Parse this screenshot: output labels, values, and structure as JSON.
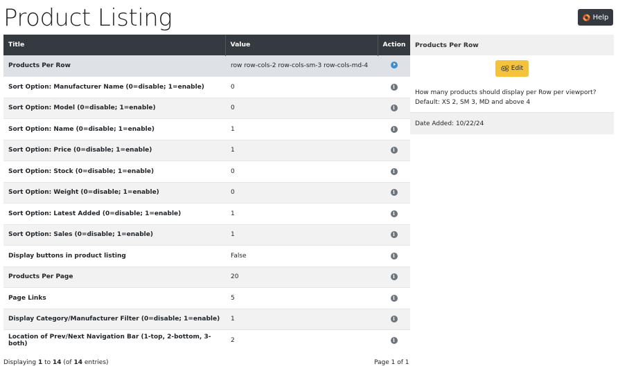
{
  "header": {
    "title": "Product Listing",
    "help_label": "Help"
  },
  "table": {
    "columns": [
      "Title",
      "Value",
      "Action"
    ],
    "rows": [
      {
        "title": "Products Per Row",
        "value": "row row-cols-2 row-cols-sm-3 row-cols-md-4",
        "action": "arrow-right-circle-icon"
      },
      {
        "title": "Sort Option: Manufacturer Name (0=disable; 1=enable)",
        "value": "0",
        "action": "info-icon"
      },
      {
        "title": "Sort Option: Model (0=disable; 1=enable)",
        "value": "0",
        "action": "info-icon"
      },
      {
        "title": "Sort Option: Name (0=disable; 1=enable)",
        "value": "1",
        "action": "info-icon"
      },
      {
        "title": "Sort Option: Price (0=disable; 1=enable)",
        "value": "1",
        "action": "info-icon"
      },
      {
        "title": "Sort Option: Stock (0=disable; 1=enable)",
        "value": "0",
        "action": "info-icon"
      },
      {
        "title": "Sort Option: Weight (0=disable; 1=enable)",
        "value": "0",
        "action": "info-icon"
      },
      {
        "title": "Sort Option: Latest Added (0=disable; 1=enable)",
        "value": "1",
        "action": "info-icon"
      },
      {
        "title": "Sort Option: Sales (0=disable; 1=enable)",
        "value": "1",
        "action": "info-icon"
      },
      {
        "title": "Display buttons in product listing",
        "value": "False",
        "action": "info-icon"
      },
      {
        "title": "Products Per Page",
        "value": "20",
        "action": "info-icon"
      },
      {
        "title": "Page Links",
        "value": "5",
        "action": "info-icon"
      },
      {
        "title": "Display Category/Manufacturer Filter (0=disable; 1=enable)",
        "value": "1",
        "action": "info-icon"
      },
      {
        "title": "Location of Prev/Next Navigation Bar (1-top, 2-bottom, 3-both)",
        "value": "2",
        "action": "info-icon"
      }
    ]
  },
  "footer": {
    "displaying_prefix": "Displaying ",
    "from": "1",
    "to_word": " to ",
    "to": "14",
    "of_open": " (of ",
    "total": "14",
    "of_close": " entries)",
    "page_info": "Page 1 of 1"
  },
  "side_panel": {
    "heading": "Products Per Row",
    "edit_label": "Edit",
    "description_line1": "How many products should display per Row per viewport?",
    "description_line2": "Default: XS 2, SM 3, MD and above 4",
    "date_added": "Date Added: 10/22/24"
  },
  "colors": {
    "header_bg": "#343a40",
    "edit_button": "#f5c33b",
    "selected_row": "#dee2e6",
    "arrow_icon": "#3f8fd0"
  }
}
